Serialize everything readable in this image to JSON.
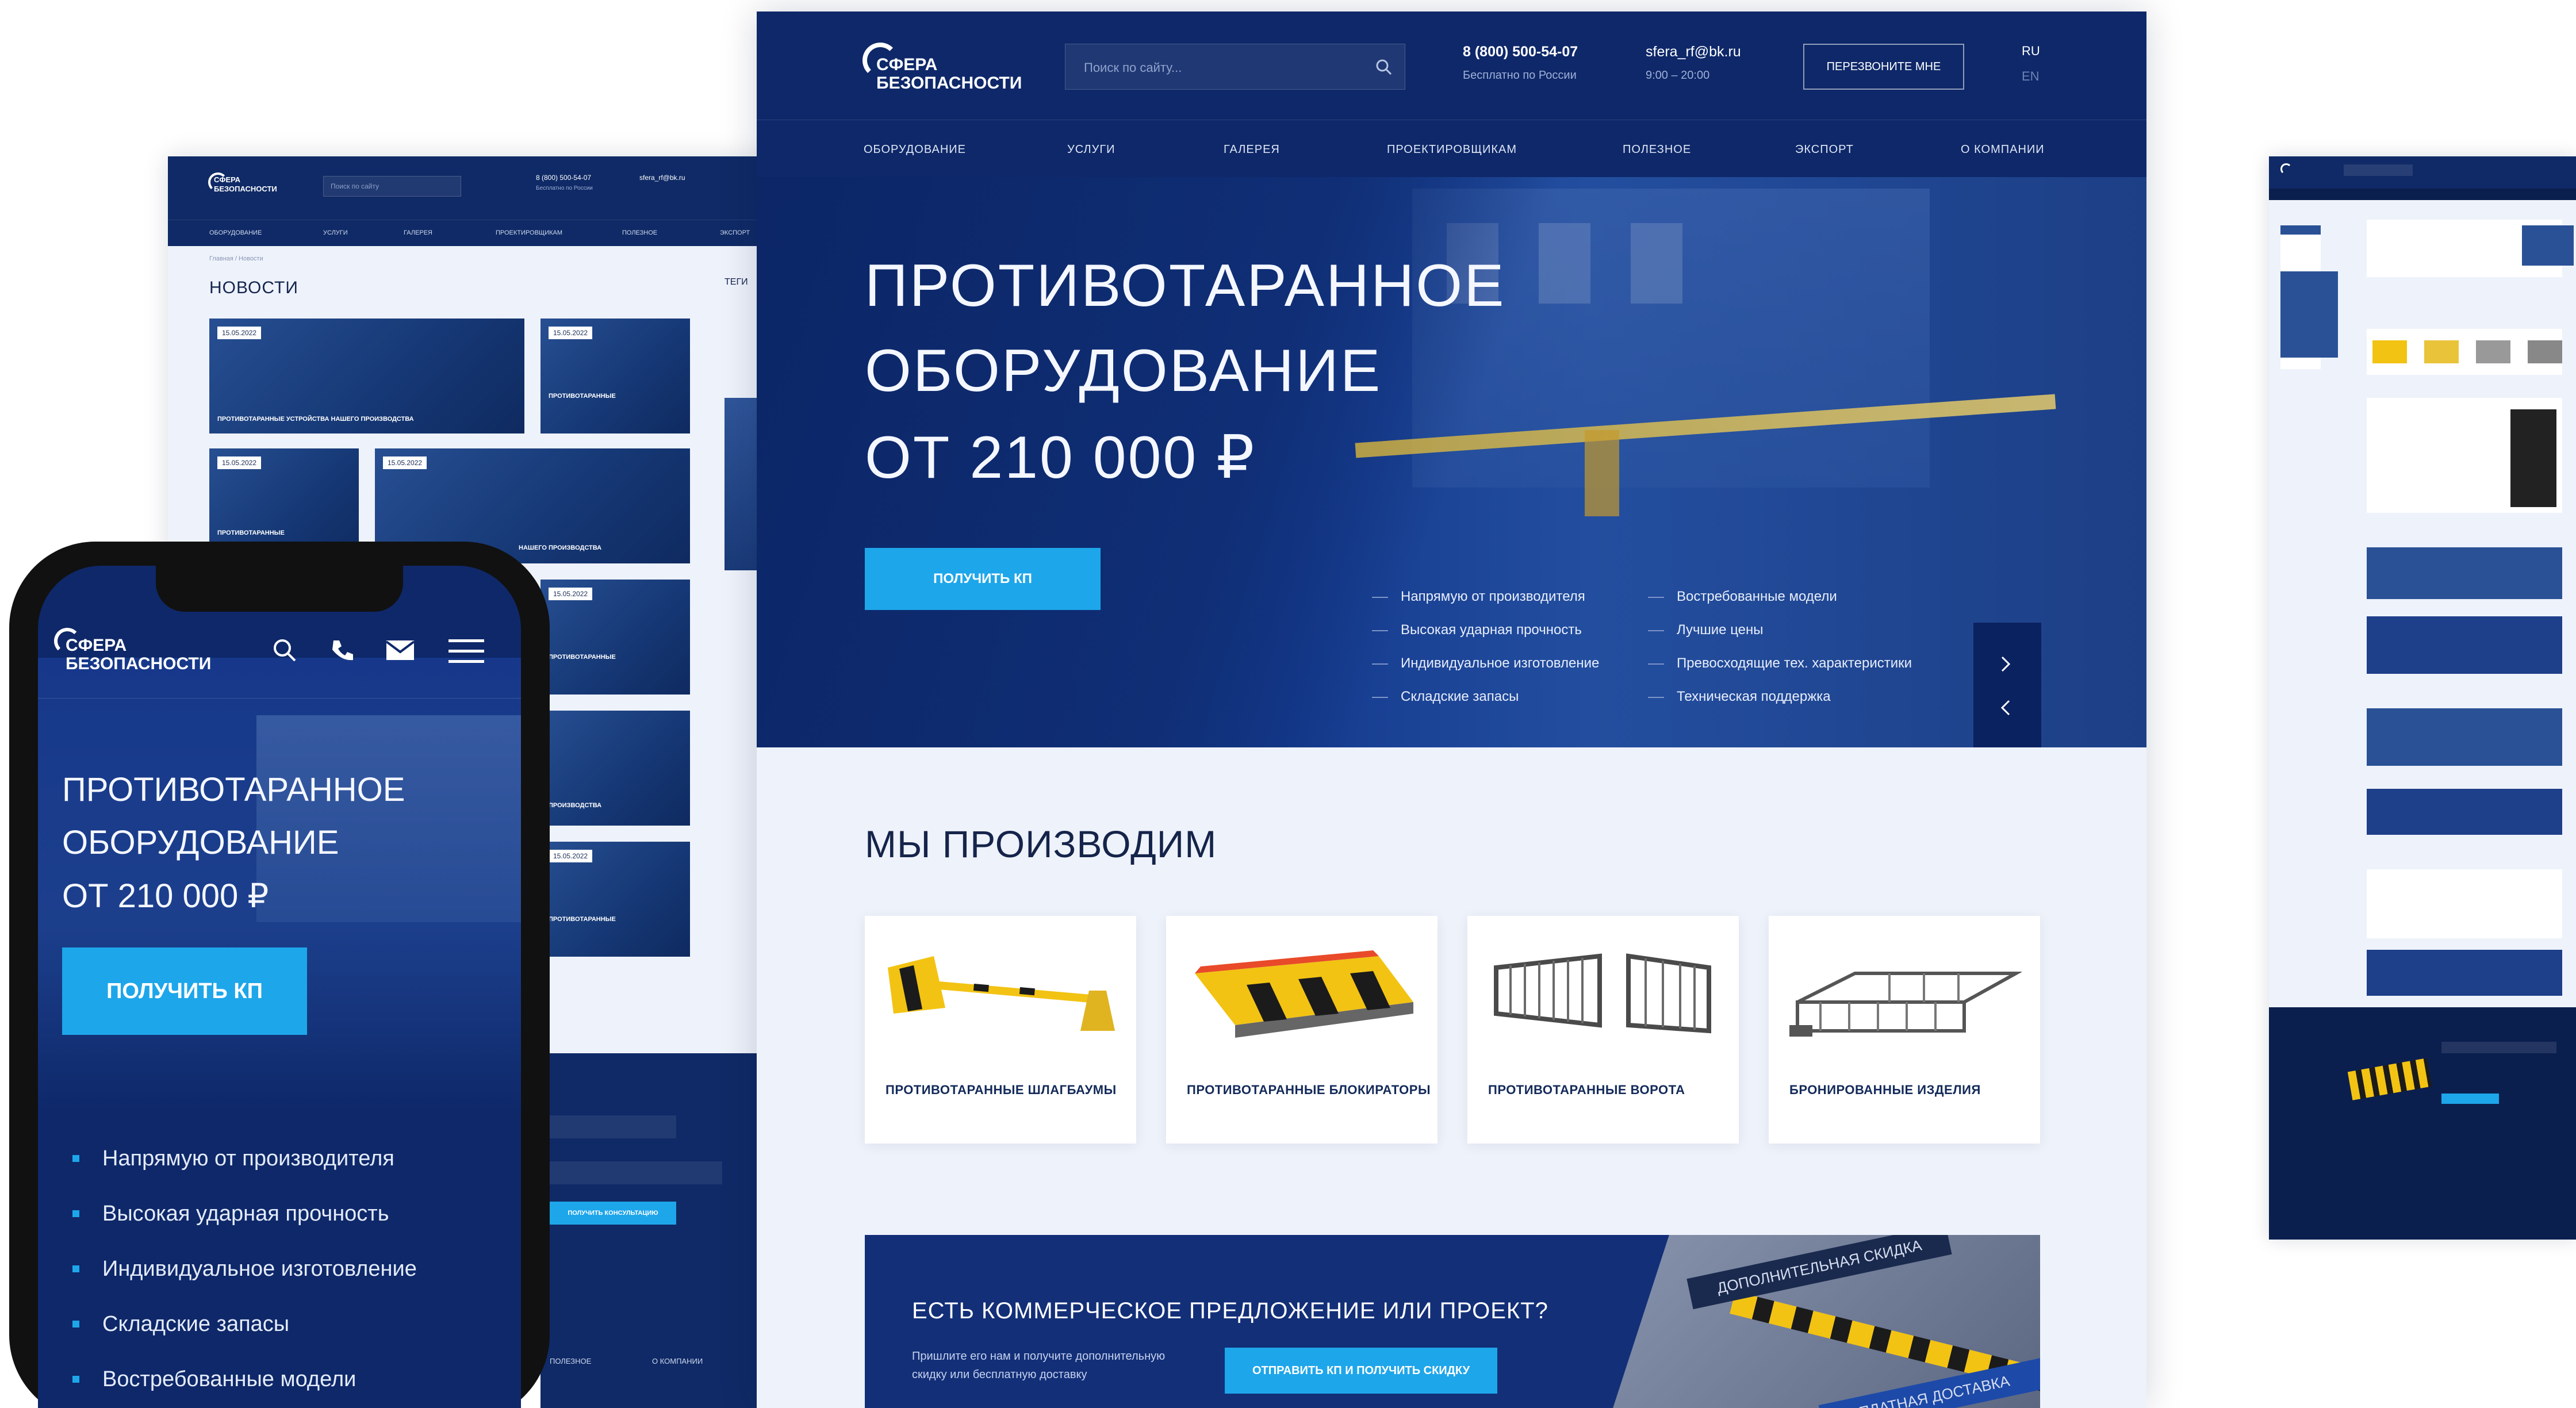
{
  "brand": {
    "line1": "СФЕРА",
    "line2": "БЕЗОПАСНОСТИ"
  },
  "header": {
    "search_placeholder": "Поиск по сайту...",
    "phone": "8 (800) 500-54-07",
    "phone_note": "Бесплатно по России",
    "email": "sfera_rf@bk.ru",
    "hours": "9:00 – 20:00",
    "callback_button": "ПЕРЕЗВОНИТЕ МНЕ",
    "lang_ru": "RU",
    "lang_en": "EN"
  },
  "menu": [
    "ОБОРУДОВАНИЕ",
    "УСЛУГИ",
    "ГАЛЕРЕЯ",
    "ПРОЕКТИРОВЩИКАМ",
    "ПОЛЕЗНОЕ",
    "ЭКСПОРТ",
    "О КОМПАНИИ"
  ],
  "hero": {
    "line1": "ПРОТИВОТАРАННОЕ",
    "line2": "ОБОРУДОВАНИЕ",
    "line3": "ОТ 210 000 ₽",
    "cta": "ПОЛУЧИТЬ КП",
    "adv_left": [
      "Напрямую от производителя",
      "Высокая ударная прочность",
      "Индивидуальное изготовление",
      "Складские запасы"
    ],
    "adv_right": [
      "Востребованные модели",
      "Лучшие цены",
      "Превосходящие тех. характеристики",
      "Техническая поддержка"
    ]
  },
  "products": {
    "title": "МЫ ПРОИЗВОДИМ",
    "items": [
      "ПРОТИВОТАРАННЫЕ ШЛАГБАУМЫ",
      "ПРОТИВОТАРАННЫЕ БЛОКИРАТОРЫ",
      "ПРОТИВОТАРАННЫЕ ВОРОТА",
      "БРОНИРОВАННЫЕ ИЗДЕЛИЯ"
    ]
  },
  "offer": {
    "title": "ЕСТЬ КОММЕРЧЕСКОЕ ПРЕДЛОЖЕНИЕ ИЛИ ПРОЕКТ?",
    "text1": "Пришлите его нам и получите дополнительную",
    "text2": "скидку или бесплатную доставку",
    "button": "ОТПРАВИТЬ КП И ПОЛУЧИТЬ СКИДКУ",
    "ribbon1": "ДОПОЛНИТЕЛЬНАЯ СКИДКА",
    "ribbon2": "ПЛАТНАЯ ДОСТАВКА"
  },
  "news_page": {
    "title": "НОВОСТИ",
    "tags": "ТЕГИ",
    "search_placeholder": "Поиск по сайту",
    "phone": "8 (800) 500-54-07",
    "email": "sfera_rf@bk.ru",
    "phone_note": "Бесплатно по России",
    "menu": [
      "ОБОРУДОВАНИЕ",
      "УСЛУГИ",
      "ГАЛЕРЕЯ",
      "ПРОЕКТИРОВЩИКАМ",
      "ПОЛЕЗНОЕ",
      "ЭКСПОРТ"
    ],
    "breadcrumb": "Главная / Новости",
    "news_date": "15.05.2022",
    "news_caption": "ПРОТИВОТАРАННЫЕ УСТРОЙСТВА НАШЕГО ПРОИЗВОДСТВА",
    "news_caption_short": "ПРОТИВОТАРАННЫЕ",
    "news_caption_tail": "НАШЕГО ПРОИЗВОДСТВА",
    "news_caption_tail2": "ПРОИЗВОДСТВА",
    "consult_button": "ПОЛУЧИТЬ КОНСУЛЬТАЦИЮ",
    "footer_cols": [
      "ПОЛЕЗНОЕ",
      "О КОМПАНИИ"
    ]
  },
  "mobile": {
    "line1": "ПРОТИВОТАРАННОЕ",
    "line2": "ОБОРУДОВАНИЕ",
    "line3": "ОТ 210 000 ₽",
    "cta": "ПОЛУЧИТЬ КП",
    "bullets": [
      "Напрямую от производителя",
      "Высокая ударная прочность",
      "Индивидуальное изготовление",
      "Складские запасы",
      "Востребованные модели"
    ]
  },
  "colors": {
    "navy": "#0e2869",
    "accent": "#1ea6ea",
    "bg": "#eef2fa"
  }
}
